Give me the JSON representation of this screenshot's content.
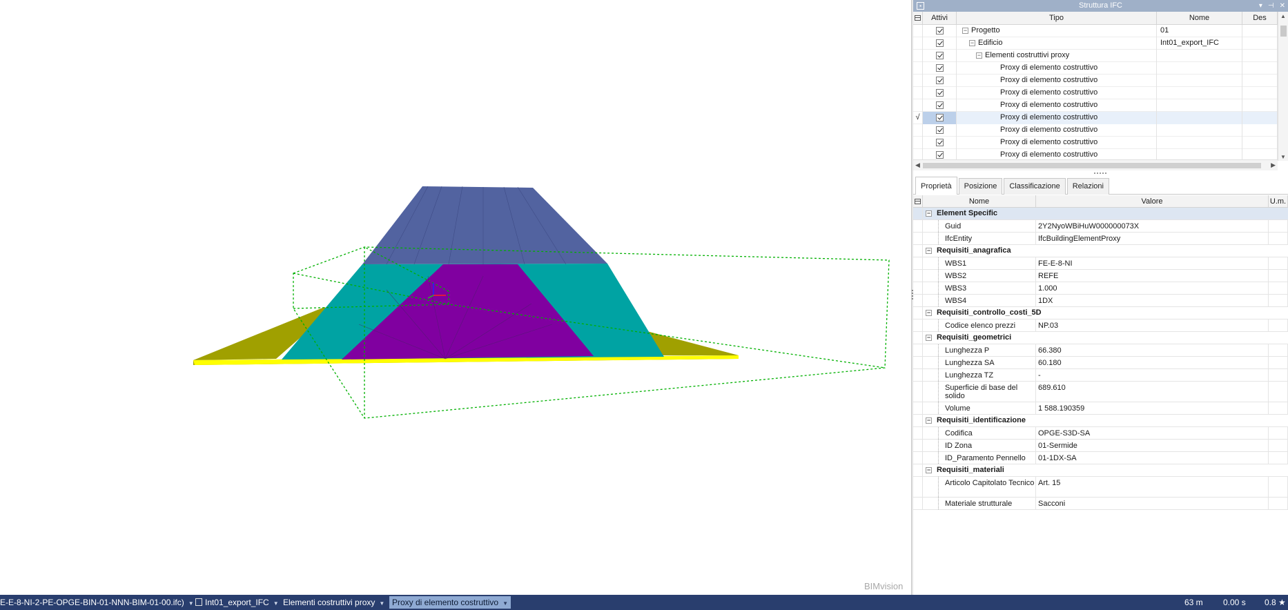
{
  "ifc_panel": {
    "title": "Struttura IFC",
    "columns": {
      "attivi": "Attivi",
      "tipo": "Tipo",
      "nome": "Nome",
      "des": "Des"
    },
    "rows": [
      {
        "tipo": "Progetto",
        "nome": "01",
        "level": 0,
        "expander": "−",
        "selected": false
      },
      {
        "tipo": "Edificio",
        "nome": "Int01_export_IFC",
        "level": 1,
        "expander": "−",
        "selected": false
      },
      {
        "tipo": "Elementi costruttivi proxy",
        "nome": "",
        "level": 2,
        "expander": "−",
        "selected": false
      },
      {
        "tipo": "Proxy di elemento costruttivo",
        "nome": "",
        "level": 3,
        "expander": "",
        "selected": false
      },
      {
        "tipo": "Proxy di elemento costruttivo",
        "nome": "",
        "level": 3,
        "expander": "",
        "selected": false
      },
      {
        "tipo": "Proxy di elemento costruttivo",
        "nome": "",
        "level": 3,
        "expander": "",
        "selected": false
      },
      {
        "tipo": "Proxy di elemento costruttivo",
        "nome": "",
        "level": 3,
        "expander": "",
        "selected": false
      },
      {
        "tipo": "Proxy di elemento costruttivo",
        "nome": "",
        "level": 3,
        "expander": "",
        "selected": true,
        "mark": "√"
      },
      {
        "tipo": "Proxy di elemento costruttivo",
        "nome": "",
        "level": 3,
        "expander": "",
        "selected": false
      },
      {
        "tipo": "Proxy di elemento costruttivo",
        "nome": "",
        "level": 3,
        "expander": "",
        "selected": false
      },
      {
        "tipo": "Proxy di elemento costruttivo",
        "nome": "",
        "level": 3,
        "expander": "",
        "selected": false
      }
    ]
  },
  "tabs": [
    {
      "label": "Proprietà",
      "active": true
    },
    {
      "label": "Posizione",
      "active": false
    },
    {
      "label": "Classificazione",
      "active": false
    },
    {
      "label": "Relazioni",
      "active": false
    }
  ],
  "properties": {
    "columns": {
      "nome": "Nome",
      "valore": "Valore",
      "um": "U.m."
    },
    "groups": [
      {
        "label": "Element Specific",
        "rows": [
          {
            "name": "Guid",
            "value": "2Y2NyoWBiHuW000000073X"
          },
          {
            "name": "IfcEntity",
            "value": "IfcBuildingElementProxy"
          }
        ]
      },
      {
        "label": "Requisiti_anagrafica",
        "rows": [
          {
            "name": "WBS1",
            "value": "FE-E-8-NI"
          },
          {
            "name": "WBS2",
            "value": "REFE"
          },
          {
            "name": "WBS3",
            "value": "1.000"
          },
          {
            "name": "WBS4",
            "value": "1DX"
          }
        ]
      },
      {
        "label": "Requisiti_controllo_costi_5D",
        "rows": [
          {
            "name": "Codice elenco prezzi",
            "value": "NP.03"
          }
        ]
      },
      {
        "label": "Requisiti_geometrici",
        "rows": [
          {
            "name": "Lunghezza P",
            "value": "66.380"
          },
          {
            "name": "Lunghezza SA",
            "value": "60.180"
          },
          {
            "name": "Lunghezza TZ",
            "value": "-"
          },
          {
            "name": "Superficie di base del solido",
            "value": "689.610"
          },
          {
            "name": "Volume",
            "value": "1 588.190359"
          }
        ]
      },
      {
        "label": "Requisiti_identificazione",
        "rows": [
          {
            "name": "Codifica",
            "value": "OPGE-S3D-SA"
          },
          {
            "name": "ID Zona",
            "value": "01-Sermide"
          },
          {
            "name": "ID_Paramento Pennello",
            "value": "01-1DX-SA"
          }
        ]
      },
      {
        "label": "Requisiti_materiali",
        "rows": [
          {
            "name": "Articolo Capitolato Tecnico",
            "value": "Art. 15"
          },
          {
            "name": "Materiale strutturale",
            "value": "Sacconi"
          }
        ]
      }
    ]
  },
  "viewport": {
    "watermark": "BIMvision",
    "colors": {
      "top": "#5263a0",
      "mid": "#00a3a3",
      "core": "#8000a0",
      "base": "#a0a000",
      "base_edge": "#ffff00",
      "bbox": "#00b000"
    }
  },
  "statusbar": {
    "breadcrumbs": [
      {
        "label": "E-E-8-NI-2-PE-OPGE-BIN-01-NNN-BIM-01-00.ifc)",
        "active": false,
        "icon": ""
      },
      {
        "label": "Int01_export_IFC",
        "active": false,
        "icon": "file-icon"
      },
      {
        "label": "Elementi costruttivi proxy",
        "active": false,
        "icon": ""
      },
      {
        "label": "Proxy di elemento costruttivo",
        "active": true,
        "icon": ""
      }
    ],
    "distance": "63 m",
    "time": "0.00 s",
    "zoom": "0.8 ★"
  }
}
